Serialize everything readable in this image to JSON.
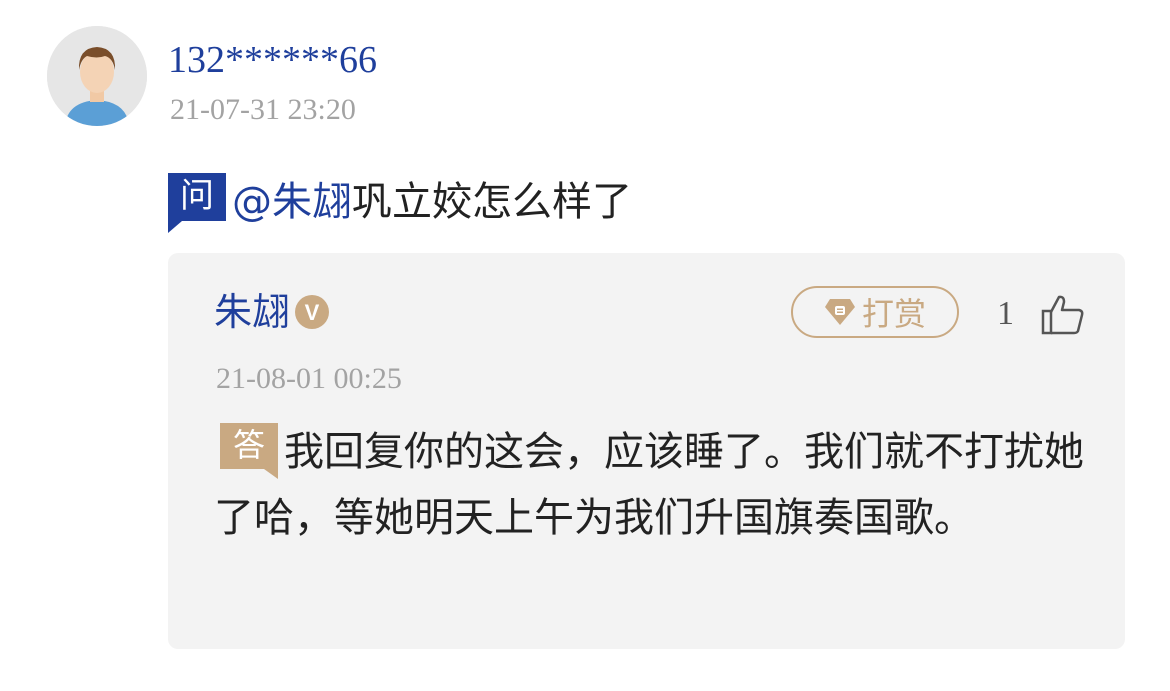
{
  "question": {
    "user": {
      "name": "132******66",
      "timestamp": "21-07-31 23:20",
      "avatar": "default-male-avatar"
    },
    "badge": "问",
    "mention": "@朱翃",
    "text": "巩立姣怎么样了"
  },
  "answer": {
    "author": "朱翃",
    "verified_badge": "V",
    "tip_label": "打赏",
    "like_count": "1",
    "timestamp": "21-08-01 00:25",
    "badge": "答",
    "text": "我回复你的这会，应该睡了。我们就不打扰她了哈，等她明天上午为我们升国旗奏国歌。"
  },
  "colors": {
    "link_blue": "#1f3f9c",
    "question_badge": "#1f3f9c",
    "answer_badge": "#c9a982",
    "muted_gray": "#a3a3a3",
    "card_bg": "#f3f3f3"
  }
}
